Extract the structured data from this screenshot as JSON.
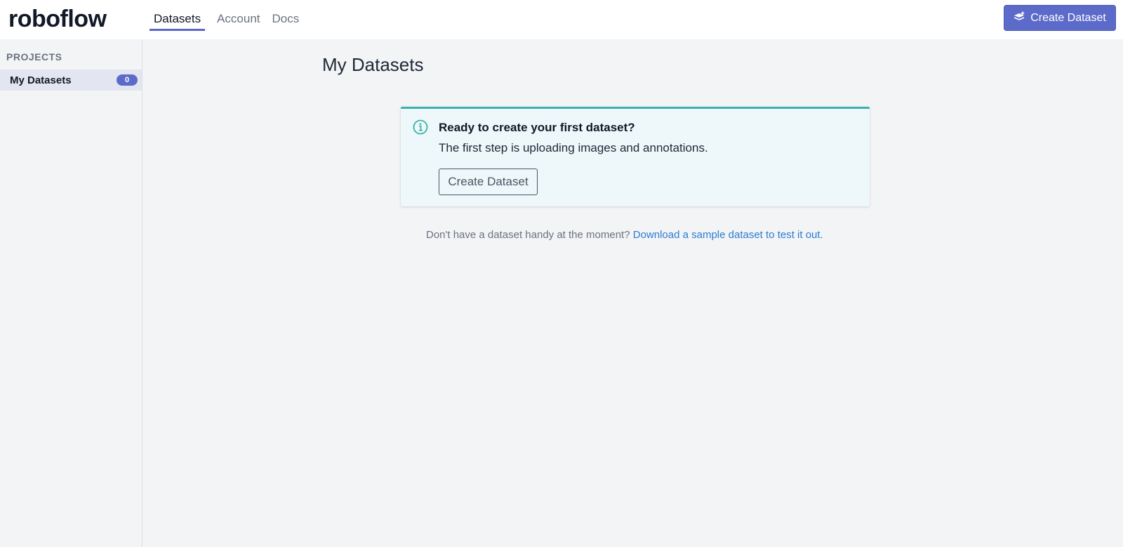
{
  "header": {
    "logo_text": "roboflow",
    "nav": [
      {
        "label": "Datasets",
        "active": true
      },
      {
        "label": "Account",
        "active": false
      },
      {
        "label": "Docs",
        "active": false
      }
    ],
    "create_button_label": "Create Dataset",
    "create_button_icon": "stack-plus-icon",
    "accent_color": "#5c6bc9"
  },
  "sidebar": {
    "section_label": "PROJECTS",
    "items": [
      {
        "label": "My Datasets",
        "count": "0"
      }
    ]
  },
  "main": {
    "title": "My Datasets",
    "callout": {
      "icon": "info-icon",
      "heading": "Ready to create your first dataset?",
      "text": "The first step is uploading images and annotations.",
      "button_label": "Create Dataset",
      "accent_color": "#38b2ac"
    },
    "helper_text": "Don't have a dataset handy at the moment?",
    "helper_link": "Download a sample dataset to test it out."
  }
}
